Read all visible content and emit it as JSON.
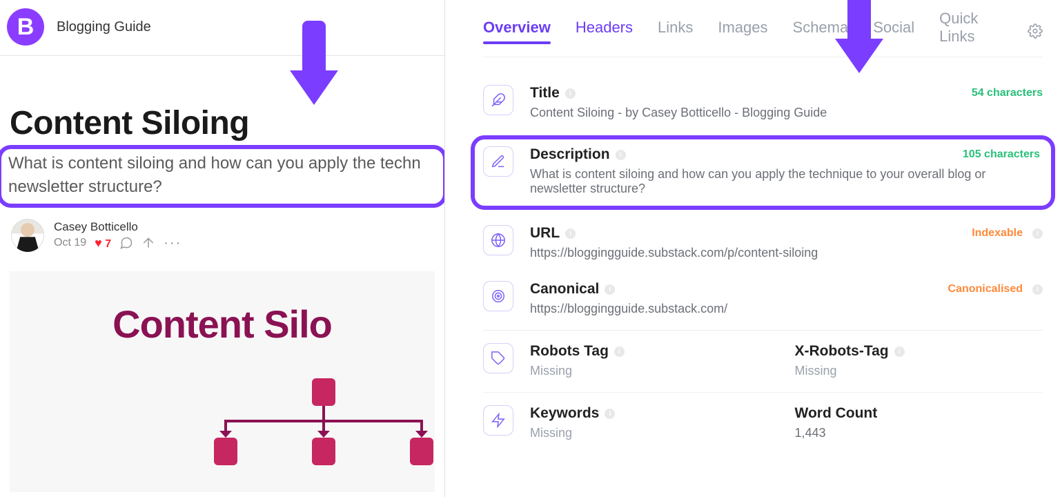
{
  "left": {
    "logo_letter": "B",
    "publication_name": "Blogging Guide",
    "post_title": "Content Siloing",
    "post_subtitle": "What is content siloing and how can you apply the techn newsletter structure?",
    "author": {
      "name": "Casey Botticello",
      "date": "Oct 19",
      "likes": "7"
    },
    "hero_title": "Content Silo"
  },
  "right": {
    "tabs": [
      "Overview",
      "Headers",
      "Links",
      "Images",
      "Schema",
      "Social",
      "Quick Links"
    ],
    "active_tab": 0,
    "cards": {
      "title": {
        "label": "Title",
        "badge": "54 characters",
        "value": "Content Siloing - by Casey Botticello - Blogging Guide"
      },
      "description": {
        "label": "Description",
        "badge": "105 characters",
        "value": "What is content siloing and how can you apply the technique to your overall blog or newsletter structure?"
      },
      "url": {
        "label": "URL",
        "badge": "Indexable",
        "value": "https://bloggingguide.substack.com/p/content-siloing"
      },
      "canonical": {
        "label": "Canonical",
        "badge": "Canonicalised",
        "value": "https://bloggingguide.substack.com/"
      },
      "robots": {
        "label": "Robots Tag",
        "value": "Missing"
      },
      "xrobots": {
        "label": "X-Robots-Tag",
        "value": "Missing"
      },
      "keywords": {
        "label": "Keywords",
        "value": "Missing"
      },
      "wordcount": {
        "label": "Word Count",
        "value": "1,443"
      }
    }
  }
}
